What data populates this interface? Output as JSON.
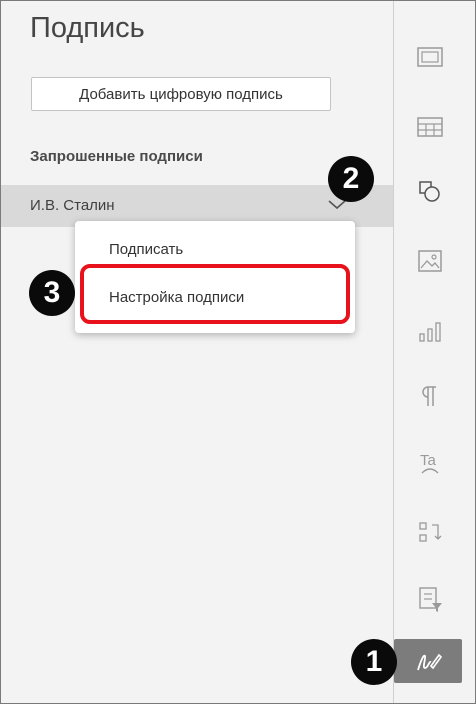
{
  "panel": {
    "title": "Подпись",
    "add_button": "Добавить цифровую подпись",
    "section_title": "Запрошенные подписи",
    "signer_name": "И.В. Сталин"
  },
  "menu": {
    "items": [
      "Подписать",
      "Настройка подписи"
    ]
  },
  "badges": {
    "one": "1",
    "two": "2",
    "three": "3"
  },
  "toolbar": {
    "icons": [
      "slide-settings-icon",
      "table-settings-icon",
      "shape-settings-icon",
      "image-settings-icon",
      "chart-settings-icon",
      "paragraph-settings-icon",
      "textart-settings-icon",
      "mail-merge-icon",
      "form-settings-icon",
      "signature-settings-icon"
    ],
    "active": "signature-settings-icon"
  },
  "colors": {
    "highlight": "#e8121c",
    "badge": "#0a0a0a",
    "active_tool": "#7c7c7c"
  }
}
